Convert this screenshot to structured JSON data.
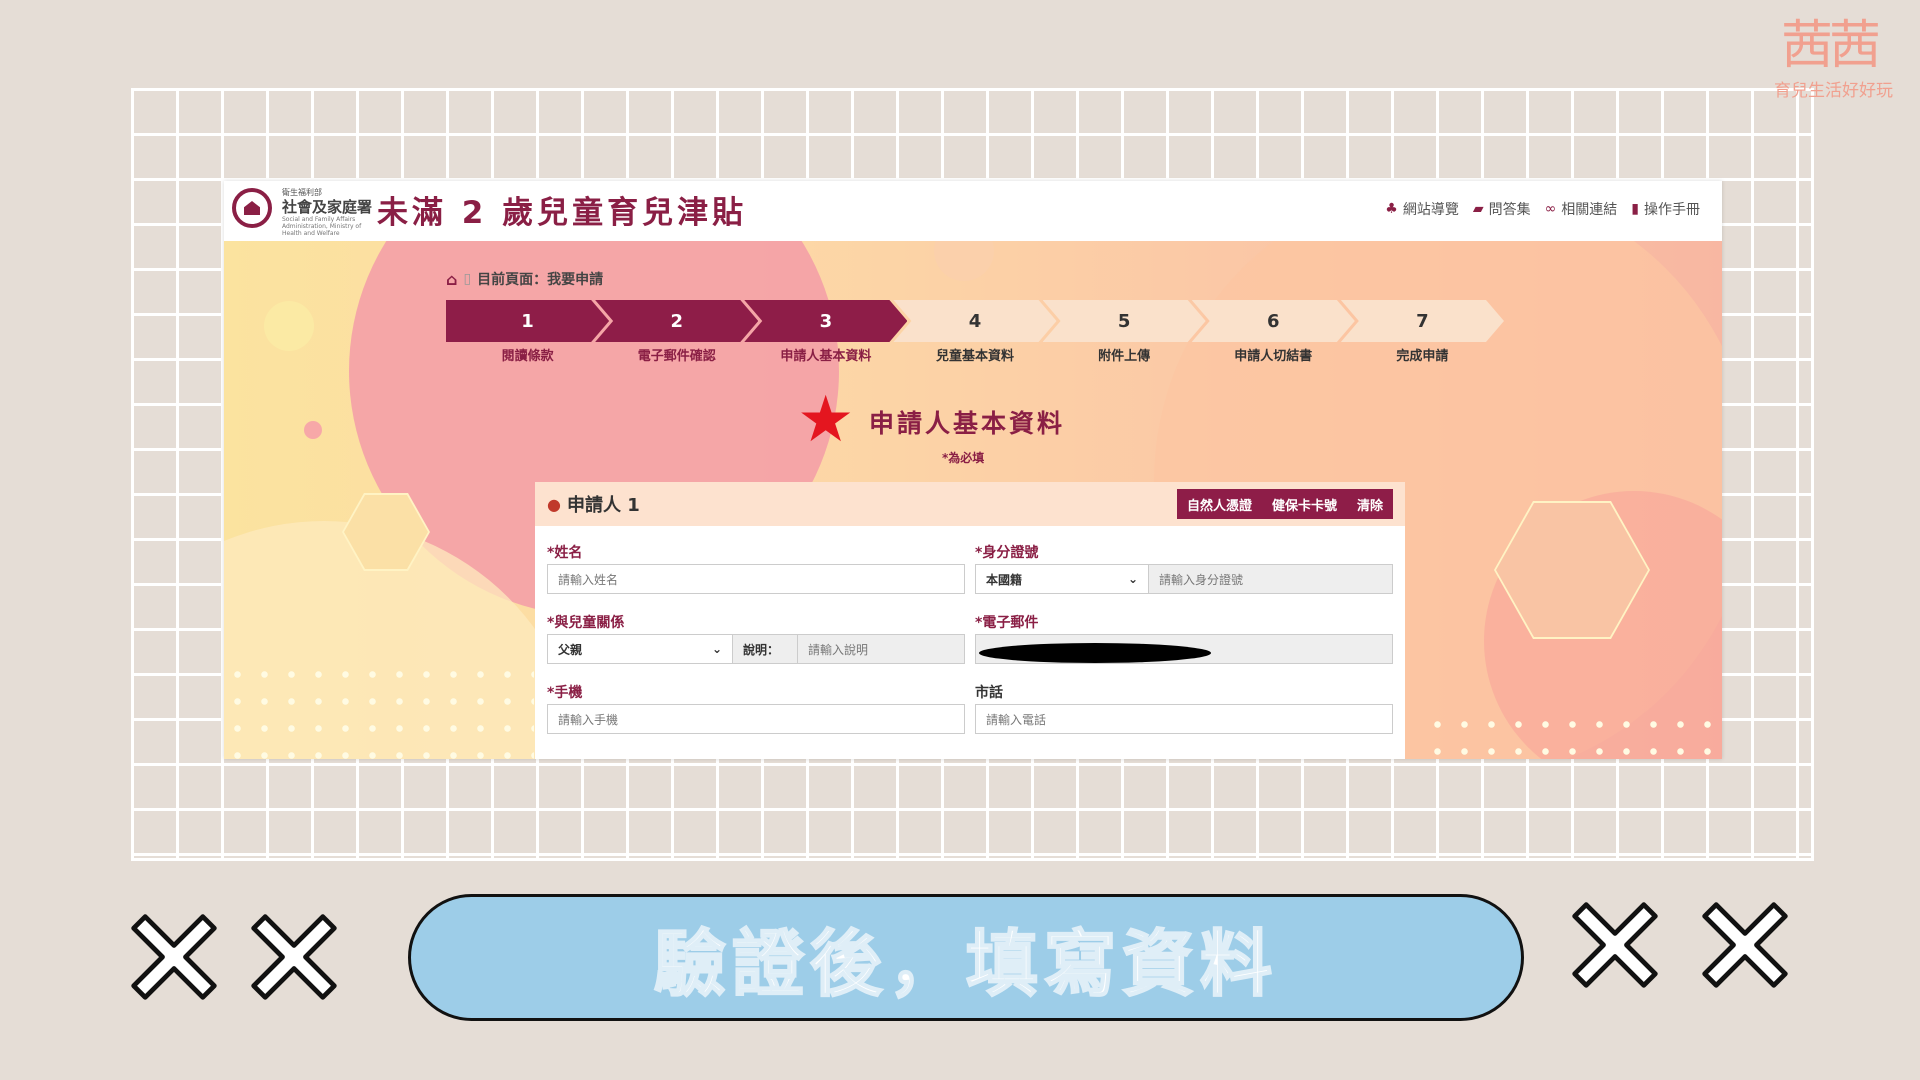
{
  "watermark": {
    "glyph": "茜茜",
    "subtitle": "育兒生活好好玩"
  },
  "header": {
    "org_small": "衛生福利部",
    "org_name": "社會及家庭署",
    "org_en": "Social and Family Affairs Administration, Ministry of Health and Welfare",
    "site_title": "未滿 2 歲兒童育兒津貼",
    "nav": [
      {
        "label": "網站導覽",
        "icon": "sitemap-icon"
      },
      {
        "label": "問答集",
        "icon": "chat-icon"
      },
      {
        "label": "相關連結",
        "icon": "link-icon"
      },
      {
        "label": "操作手冊",
        "icon": "book-icon"
      }
    ]
  },
  "breadcrumb": {
    "separator": "▯",
    "label": "目前頁面：我要申請"
  },
  "stepper": {
    "current": 3,
    "steps": [
      {
        "num": "1",
        "label": "閱讀條款"
      },
      {
        "num": "2",
        "label": "電子郵件確認"
      },
      {
        "num": "3",
        "label": "申請人基本資料"
      },
      {
        "num": "4",
        "label": "兒童基本資料"
      },
      {
        "num": "5",
        "label": "附件上傳"
      },
      {
        "num": "6",
        "label": "申請人切結書"
      },
      {
        "num": "7",
        "label": "完成申請"
      }
    ]
  },
  "section": {
    "title": "申請人基本資料",
    "required_note": "*為必填"
  },
  "form": {
    "card_title": "申請人 1",
    "buttons": [
      "自然人憑證",
      "健保卡卡號",
      "清除"
    ],
    "name": {
      "label": "姓名",
      "placeholder": "請輸入姓名"
    },
    "id": {
      "label": "身分證號",
      "nationality": "本國籍",
      "placeholder": "請輸入身分證號"
    },
    "relation": {
      "label": "與兒童關係",
      "value": "父親",
      "note_label": "說明：",
      "note_placeholder": "請輸入說明"
    },
    "email": {
      "label": "電子郵件"
    },
    "mobile": {
      "label": "手機",
      "placeholder": "請輸入手機"
    },
    "phone": {
      "label": "市話",
      "placeholder": "請輸入電話"
    },
    "required_mark": "*"
  },
  "banner": {
    "text": "驗證後，填寫資料"
  },
  "colors": {
    "brand": "#8e1d48",
    "banner": "#9dcde8",
    "background": "#e5ddd6"
  }
}
